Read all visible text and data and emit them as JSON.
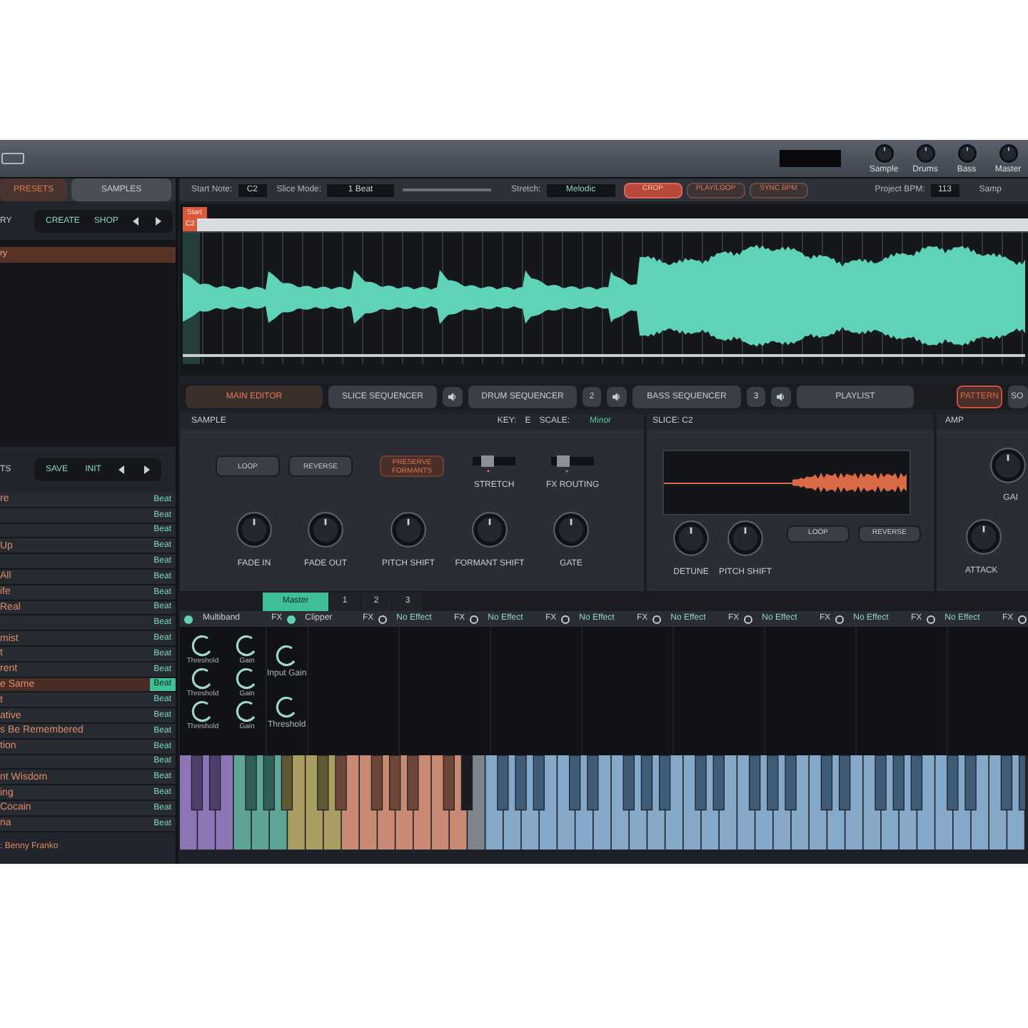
{
  "mixer_knobs": [
    "Sample",
    "Drums",
    "Bass",
    "Master"
  ],
  "sidebar": {
    "tabs": [
      {
        "label": "PRESETS",
        "selected": true
      },
      {
        "label": "SAMPLES",
        "selected": false
      }
    ],
    "library": {
      "title": "RY",
      "actions": [
        "CREATE",
        "SHOP"
      ],
      "items": [
        {
          "name": "ry",
          "selected": true
        }
      ]
    },
    "presets": {
      "title": "TS",
      "actions": [
        "SAVE",
        "INIT"
      ],
      "items": [
        {
          "name": "re",
          "tag": "Beat",
          "selected": false
        },
        {
          "tag": "Beat",
          "selected": false
        },
        {
          "tag": "Beat",
          "selected": false
        },
        {
          "name": "Up",
          "tag": "Beat",
          "selected": false
        },
        {
          "tag": "Beat",
          "selected": false
        },
        {
          "name": "All",
          "tag": "Beat",
          "selected": false
        },
        {
          "name": "ife",
          "tag": "Beat",
          "selected": false
        },
        {
          "name": "Real",
          "tag": "Beat",
          "selected": false
        },
        {
          "tag": "Beat",
          "selected": false
        },
        {
          "name": "mist",
          "tag": "Beat",
          "selected": false
        },
        {
          "name": "t",
          "tag": "Beat",
          "selected": false
        },
        {
          "name": "rent",
          "tag": "Beat",
          "selected": false
        },
        {
          "name": "e Same",
          "tag": "Beat",
          "selected": true
        },
        {
          "name": "t",
          "tag": "Beat",
          "selected": false
        },
        {
          "name": "ative",
          "tag": "Beat",
          "selected": false
        },
        {
          "name": "s Be Remembered",
          "tag": "Beat",
          "selected": false
        },
        {
          "name": "tion",
          "tag": "Beat",
          "selected": false
        },
        {
          "tag": "Beat",
          "selected": false
        },
        {
          "name": "nt Wisdom",
          "tag": "Beat",
          "selected": false
        },
        {
          "name": "ing",
          "tag": "Beat",
          "selected": false
        },
        {
          "name": "Cocain",
          "tag": "Beat",
          "selected": false
        },
        {
          "name": "na",
          "tag": "Beat",
          "selected": false
        }
      ]
    },
    "footer": ": Benny Franko"
  },
  "controls": {
    "start_note_label": "Start Note:",
    "start_note": "C2",
    "slice_mode_label": "Slice Mode:",
    "slice_mode": "1 Beat",
    "stretch_label": "Stretch:",
    "stretch": "Melodic",
    "buttons": [
      {
        "label": "CROP",
        "on": true
      },
      {
        "label": "PLAY/LOOP",
        "on": false
      },
      {
        "label": "SYNC BPM",
        "on": false
      }
    ],
    "bpm_label": "Project BPM:",
    "bpm": "113",
    "cut_label": "Samp"
  },
  "waveform": {
    "start_tag": "Start",
    "first_slice": "C2"
  },
  "editor_tabs": [
    {
      "kind": "tab",
      "label": "MAIN EDITOR",
      "selected": true
    },
    {
      "kind": "tab",
      "label": "SLICE SEQUENCER",
      "selected": false
    },
    {
      "kind": "mute"
    },
    {
      "kind": "tab",
      "label": "DRUM SEQUENCER",
      "selected": false
    },
    {
      "kind": "number",
      "label": "2"
    },
    {
      "kind": "mute"
    },
    {
      "kind": "tab",
      "label": "BASS SEQUENCER",
      "selected": false
    },
    {
      "kind": "number",
      "label": "3"
    },
    {
      "kind": "mute"
    },
    {
      "kind": "tab",
      "label": "PLAYLIST",
      "selected": false
    }
  ],
  "view_tabs": [
    {
      "label": "PATTERN",
      "selected": true
    },
    {
      "label": "SO",
      "selected": false
    }
  ],
  "sample": {
    "title": "SAMPLE",
    "key_label": "KEY:",
    "key": "E",
    "scale_label": "SCALE:",
    "scale": "Minor",
    "buttons": [
      {
        "label": "LOOP",
        "on": false
      },
      {
        "label": "REVERSE",
        "on": false
      },
      {
        "label": "PRESERVE FORMANTS",
        "on": true
      }
    ],
    "switches": [
      "STRETCH",
      "FX ROUTING"
    ],
    "knobs": [
      "FADE IN",
      "FADE OUT",
      "PITCH SHIFT",
      "FORMANT SHIFT",
      "GATE"
    ]
  },
  "slice": {
    "title": "SLICE: C2",
    "knobs": [
      "DETUNE",
      "PITCH SHIFT"
    ],
    "buttons": [
      "LOOP",
      "REVERSE"
    ]
  },
  "amp": {
    "title": "AMP",
    "knobs": [
      "GAI",
      "ATTACK"
    ]
  },
  "fx": {
    "tabs": [
      {
        "label": "Master",
        "selected": true
      },
      {
        "label": "1",
        "selected": false
      },
      {
        "label": "2",
        "selected": false
      },
      {
        "label": "3",
        "selected": false
      }
    ],
    "slots": [
      {
        "name": "Multiband",
        "on": true
      },
      {
        "label": "FX",
        "name": "Clipper",
        "on": true
      },
      {
        "label": "FX",
        "name": "No Effect",
        "on": false
      },
      {
        "label": "FX",
        "name": "No Effect",
        "on": false
      },
      {
        "label": "FX",
        "name": "No Effect",
        "on": false
      },
      {
        "label": "FX",
        "name": "No Effect",
        "on": false
      },
      {
        "label": "FX",
        "name": "No Effect",
        "on": false
      },
      {
        "label": "FX",
        "name": "No Effect",
        "on": false
      },
      {
        "label": "FX",
        "name": "No Effect",
        "on": false
      },
      {
        "label": "FX",
        "on": false
      }
    ],
    "multiband": [
      [
        "Threshold",
        "Gain"
      ],
      [
        "Threshold",
        "Gain"
      ],
      [
        "Threshold",
        "Gain"
      ]
    ],
    "clipper": [
      "Input Gain",
      "Threshold"
    ]
  }
}
